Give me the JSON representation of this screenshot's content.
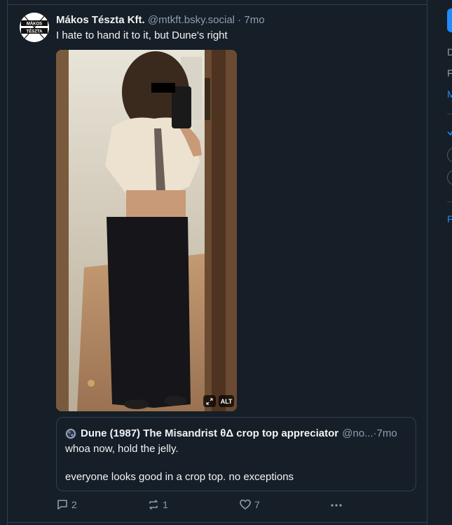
{
  "post": {
    "display_name": "Mákos Tészta Kft.",
    "handle": "@mtkft.bsky.social",
    "separator": " · ",
    "time": "7mo",
    "text": "I hate to hand it to it, but Dune's right",
    "avatar_text_top": "MÁKOS",
    "avatar_text_bottom": "TÉSZTA",
    "image_alt_badge": "ALT"
  },
  "quote": {
    "display_name": "Dune (1987) The Misandrist θΔ crop top appreciator",
    "handle": "@no...",
    "separator": " · ",
    "time": "7mo",
    "text_line1": "whoa now, hold the jelly.",
    "text_line2": "everyone looks good in a crop top. no exceptions"
  },
  "actions": {
    "reply_count": "2",
    "repost_count": "1",
    "like_count": "7"
  },
  "right_panel": {
    "letters": [
      "D",
      "F",
      "M",
      "F"
    ]
  },
  "colors": {
    "background": "#161e27",
    "border": "#2e4052",
    "muted_text": "#8d9eb2",
    "accent": "#208bfe"
  }
}
